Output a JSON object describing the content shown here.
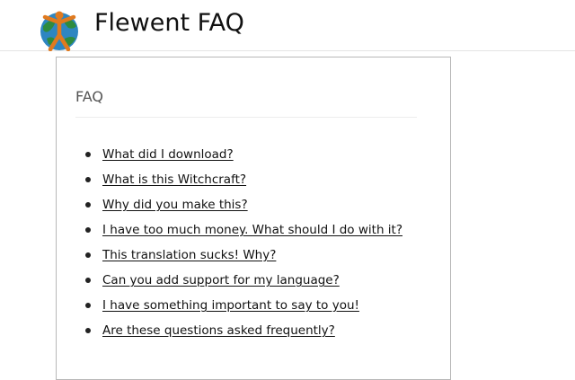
{
  "header": {
    "title": "Flewent FAQ",
    "logo_icon": "globe-person-icon"
  },
  "faq": {
    "heading": "FAQ",
    "questions": [
      "What did I download?",
      "What is this Witchcraft?",
      "Why did you make this?",
      "I have too much money. What should I do with it?",
      "This translation sucks! Why?",
      "Can you add support for my language?",
      "I have something important to say to you!",
      "Are these questions asked frequently?"
    ]
  },
  "colors": {
    "globe_water": "#2e86c1",
    "globe_land": "#2e8b3e",
    "figure": "#e07a1f"
  }
}
